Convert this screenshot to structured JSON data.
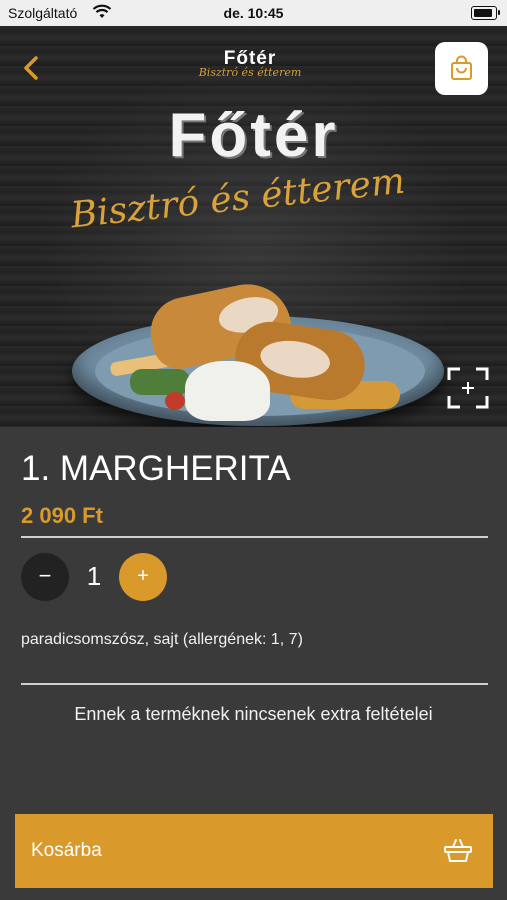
{
  "status_bar": {
    "carrier": "Szolgáltató",
    "time": "de. 10:45"
  },
  "header": {
    "logo_main": "Főtér",
    "logo_sub": "Bisztró és étterem"
  },
  "hero": {
    "logo_main": "Főtér",
    "logo_sub": "Bisztró és étterem"
  },
  "product": {
    "title": "1. MARGHERITA",
    "price": "2 090 Ft",
    "quantity": "1",
    "minus_label": "−",
    "plus_label": "+",
    "description": "paradicsomszósz, sajt (allergének: 1, 7)",
    "no_extras": "Ennek a terméknek nincsenek extra feltételei"
  },
  "cart_button": {
    "label": "Kosárba"
  },
  "colors": {
    "accent": "#d99a2b",
    "background": "#3a3a3a"
  },
  "icons": [
    "back-chevron-icon",
    "shopping-bag-icon",
    "expand-icon",
    "basket-icon",
    "wifi-icon",
    "battery-icon"
  ]
}
